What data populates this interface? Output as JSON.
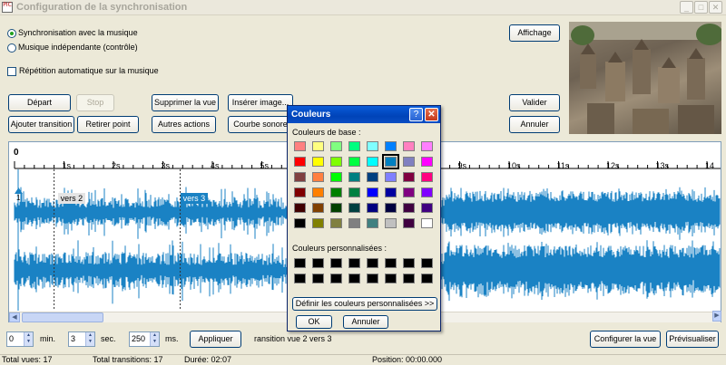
{
  "window": {
    "title": "Configuration de la synchronisation",
    "icon_text": "PIC",
    "minimize": "_",
    "maximize": "□",
    "close": "✕"
  },
  "options": {
    "sync_music": "Synchronisation avec la musique",
    "independent_music": "Musique indépendante (contrôle)",
    "auto_repeat": "Répétition automatique sur la musique",
    "selected": "sync_music"
  },
  "buttons": {
    "start": "Départ",
    "stop": "Stop",
    "delete_view": "Supprimer la vue",
    "insert_image": "Insérer image...",
    "add_transition": "Ajouter transition",
    "remove_point": "Retirer point",
    "other_actions": "Autres actions",
    "sound_curve": "Courbe sonore",
    "display": "Affichage",
    "validate": "Valider",
    "cancel": "Annuler",
    "apply": "Appliquer",
    "configure_view": "Configurer la vue",
    "preview": "Prévisualiser"
  },
  "timeline": {
    "start_label": "0",
    "ticks": [
      "1s",
      "2s",
      "3s",
      "4s",
      "5s",
      "9s",
      "10s",
      "11s",
      "12s",
      "13s",
      "14"
    ],
    "markers": [
      {
        "label": "vers 2",
        "seconds": 0.8
      },
      {
        "label": "vers 3",
        "seconds": 3.35
      }
    ],
    "marker_index": "1",
    "wave_color": "#1a82c4"
  },
  "time_inputs": {
    "min_value": "0",
    "min_unit": "min.",
    "sec_value": "3",
    "sec_unit": "sec.",
    "ms_value": "250",
    "ms_unit": "ms.",
    "transition_text": "ransition vue 2 vers 3"
  },
  "status": {
    "total_views": "Total vues: 17",
    "total_transitions": "Total transitions: 17",
    "duration": "Durée: 02:07",
    "position": "Position: 00:00.000"
  },
  "color_dialog": {
    "title": "Couleurs",
    "help": "?",
    "close": "✕",
    "basic_label": "Couleurs de base :",
    "custom_label": "Couleurs personnalisées :",
    "define_button": "Définir les couleurs personnalisées >>",
    "ok": "OK",
    "cancel": "Annuler",
    "selected_index": 13,
    "basic_colors": [
      "#ff8080",
      "#ffff80",
      "#80ff80",
      "#00ff80",
      "#80ffff",
      "#0080ff",
      "#ff80c0",
      "#ff80ff",
      "#ff0000",
      "#ffff00",
      "#80ff00",
      "#00ff40",
      "#00ffff",
      "#0080c0",
      "#8080c0",
      "#ff00ff",
      "#804040",
      "#ff8040",
      "#00ff00",
      "#008080",
      "#004080",
      "#8080ff",
      "#800040",
      "#ff0080",
      "#800000",
      "#ff8000",
      "#008000",
      "#008040",
      "#0000ff",
      "#0000a0",
      "#800080",
      "#8000ff",
      "#400000",
      "#804000",
      "#004000",
      "#004040",
      "#000080",
      "#000040",
      "#400040",
      "#400080",
      "#000000",
      "#808000",
      "#808040",
      "#808080",
      "#408080",
      "#c0c0c0",
      "#400040",
      "#ffffff"
    ],
    "custom_colors": [
      "#000000",
      "#000000",
      "#000000",
      "#000000",
      "#000000",
      "#000000",
      "#000000",
      "#000000",
      "#000000",
      "#000000",
      "#000000",
      "#000000",
      "#000000",
      "#000000",
      "#000000",
      "#000000"
    ]
  }
}
